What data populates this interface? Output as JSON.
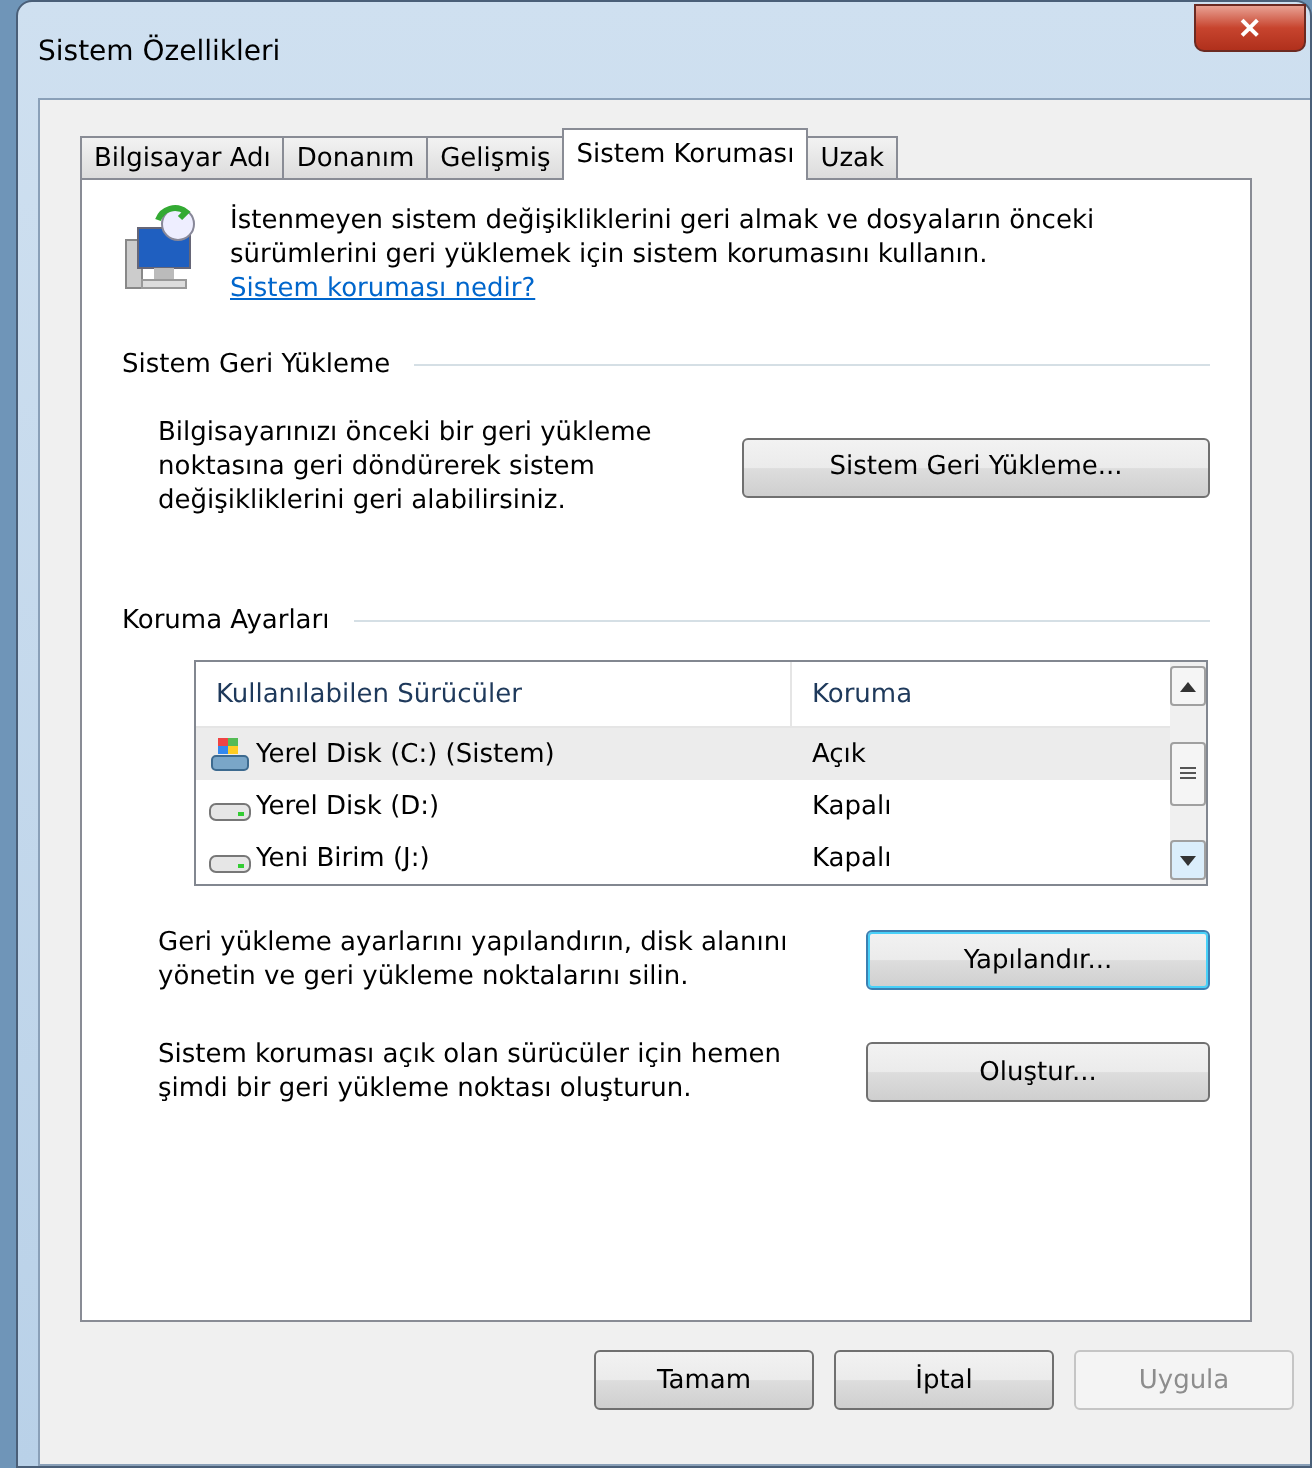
{
  "window": {
    "title": "Sistem Özellikleri",
    "close_label": "✕"
  },
  "tabs": [
    {
      "label": "Bilgisayar Adı",
      "selected": false
    },
    {
      "label": "Donanım",
      "selected": false
    },
    {
      "label": "Gelişmiş",
      "selected": false
    },
    {
      "label": "Sistem Koruması",
      "selected": true
    },
    {
      "label": "Uzak",
      "selected": false
    }
  ],
  "intro": {
    "text": "İstenmeyen sistem değişikliklerini geri almak ve dosyaların önceki sürümlerini geri yüklemek için sistem korumasını kullanın.",
    "link": "Sistem koruması nedir?"
  },
  "restore_section": {
    "title": "Sistem Geri Yükleme",
    "text": "Bilgisayarınızı önceki bir geri yükleme noktasına geri döndürerek sistem değişikliklerini geri alabilirsiniz.",
    "button": {
      "label": "Sistem Geri Yükleme...",
      "default": false,
      "disabled": false
    }
  },
  "protection_section": {
    "title": "Koruma Ayarları",
    "table": {
      "columns": [
        "Kullanılabilen Sürücüler",
        "Koruma"
      ],
      "rows": [
        {
          "kind": "system",
          "drive": "Yerel Disk (C:) (Sistem)",
          "protection": "Açık",
          "selected": true
        },
        {
          "kind": "disk",
          "drive": "Yerel Disk (D:)",
          "protection": "Kapalı",
          "selected": false
        },
        {
          "kind": "disk",
          "drive": "Yeni Birim (J:)",
          "protection": "Kapalı",
          "selected": false
        }
      ]
    },
    "actions": [
      {
        "text": "Geri yükleme ayarlarını yapılandırın, disk alanını yönetin ve geri yükleme noktalarını silin.",
        "button": {
          "label": "Yapılandır...",
          "default": true,
          "disabled": false
        }
      },
      {
        "text": "Sistem koruması açık olan sürücüler için hemen şimdi bir geri yükleme noktası oluşturun.",
        "button": {
          "label": "Oluştur...",
          "default": false,
          "disabled": false
        }
      }
    ]
  },
  "buttons": [
    {
      "label": "Tamam",
      "default": false,
      "disabled": false
    },
    {
      "label": "İptal",
      "default": false,
      "disabled": false
    },
    {
      "label": "Uygula",
      "default": false,
      "disabled": true
    }
  ]
}
